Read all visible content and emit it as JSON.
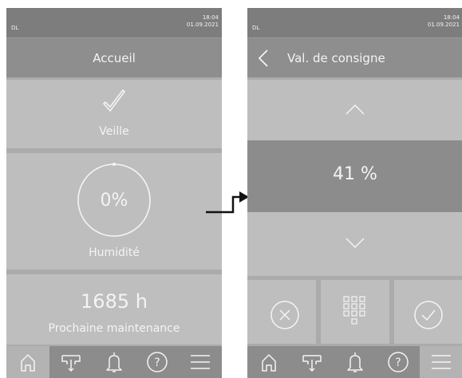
{
  "left_screen": {
    "status": {
      "left": "DL",
      "time": "18:04",
      "date": "01.09.2021"
    },
    "title": "Accueil",
    "standby_tile": {
      "icon": "checkmark-icon",
      "label": "Veille"
    },
    "humidity_tile": {
      "value": "0%",
      "label": "Humidité",
      "level_fraction": 0.0
    },
    "maintenance_tile": {
      "hours": "1685 h",
      "label": "Prochaine maintenance"
    },
    "nav": [
      {
        "icon": "home-icon",
        "active": true
      },
      {
        "icon": "humidifier-icon",
        "active": false
      },
      {
        "icon": "bell-icon",
        "active": false
      },
      {
        "icon": "help-icon",
        "active": false
      },
      {
        "icon": "menu-icon",
        "active": false
      }
    ]
  },
  "right_screen": {
    "status": {
      "left": "DL",
      "time": "18:04",
      "date": "01.09.2021"
    },
    "title": "Val. de consigne",
    "setpoint_value": "41 %",
    "actions": [
      {
        "icon": "cancel-icon"
      },
      {
        "icon": "keypad-icon"
      },
      {
        "icon": "confirm-icon"
      }
    ],
    "nav": [
      {
        "icon": "home-icon",
        "active": false
      },
      {
        "icon": "humidifier-icon",
        "active": false
      },
      {
        "icon": "bell-icon",
        "active": false
      },
      {
        "icon": "help-icon",
        "active": false
      },
      {
        "icon": "menu-icon",
        "active": true
      }
    ]
  },
  "colors": {
    "header": "#7d7d7d",
    "title_bar": "#8e8e8e",
    "tile": "#bebebe",
    "highlight": "#8c8c8c",
    "text": "#f4f4f4"
  }
}
